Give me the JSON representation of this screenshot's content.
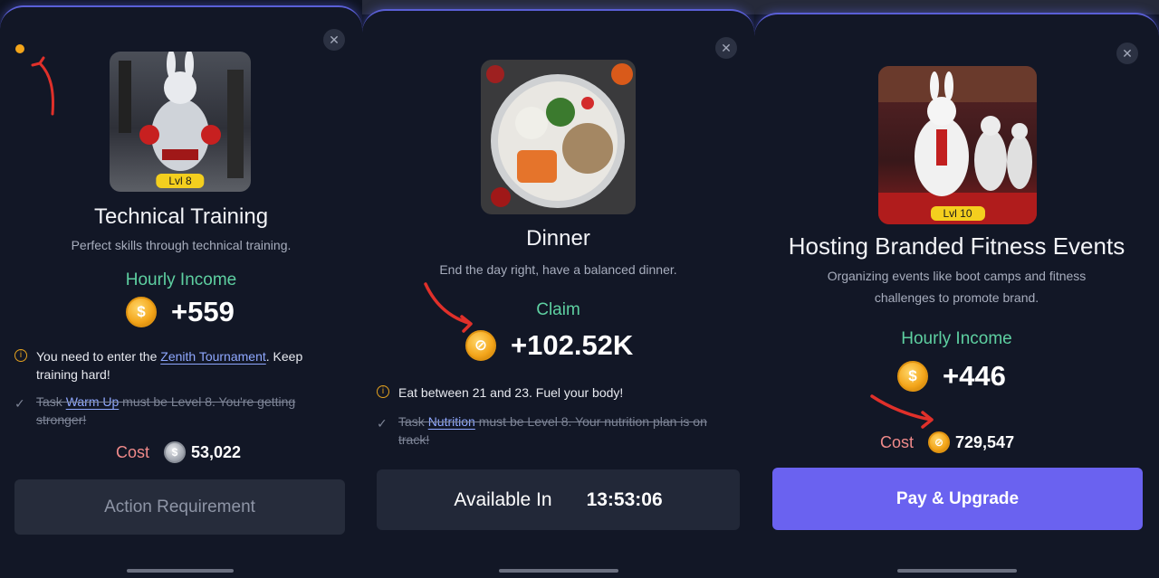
{
  "colors": {
    "income_label": "#5ed0a1",
    "cost_label": "#f08a8a",
    "link": "#8fa8ff",
    "accent_button": "#6a62f0",
    "coin_gold": "#f3a51a"
  },
  "panels": [
    {
      "image_badge": "Lvl 8",
      "title": "Technical Training",
      "description": "Perfect skills through technical training.",
      "income_label": "Hourly Income",
      "income_value": "+559",
      "requirement_prefix": "You need to enter the ",
      "requirement_link": "Zenith Tournament",
      "requirement_suffix": ". Keep training hard!",
      "task_prefix": "Task ",
      "task_link": "Warm Up",
      "task_suffix": " must be Level 8. You're getting stronger!",
      "cost_label": "Cost",
      "cost_value": "53,022",
      "button_label": "Action Requirement"
    },
    {
      "title": "Dinner",
      "description": "End the day right, have a balanced dinner.",
      "claim_label": "Claim",
      "claim_value": "+102.52K",
      "requirement_text": "Eat between 21 and 23. Fuel your body!",
      "task_prefix": "Task ",
      "task_link": "Nutrition",
      "task_suffix": " must be Level 8. Your nutrition plan is on track!",
      "button_label": "Available In",
      "timer": "13:53:06"
    },
    {
      "image_badge": "Lvl 10",
      "title": "Hosting Branded Fitness Events",
      "description": "Organizing events like boot camps and fitness challenges to promote brand.",
      "income_label": "Hourly Income",
      "income_value": "+446",
      "cost_label": "Cost",
      "cost_value": "729,547",
      "button_label": "Pay & Upgrade"
    }
  ],
  "icons": [
    "close-icon",
    "coin-icon",
    "info-icon",
    "check-icon"
  ]
}
